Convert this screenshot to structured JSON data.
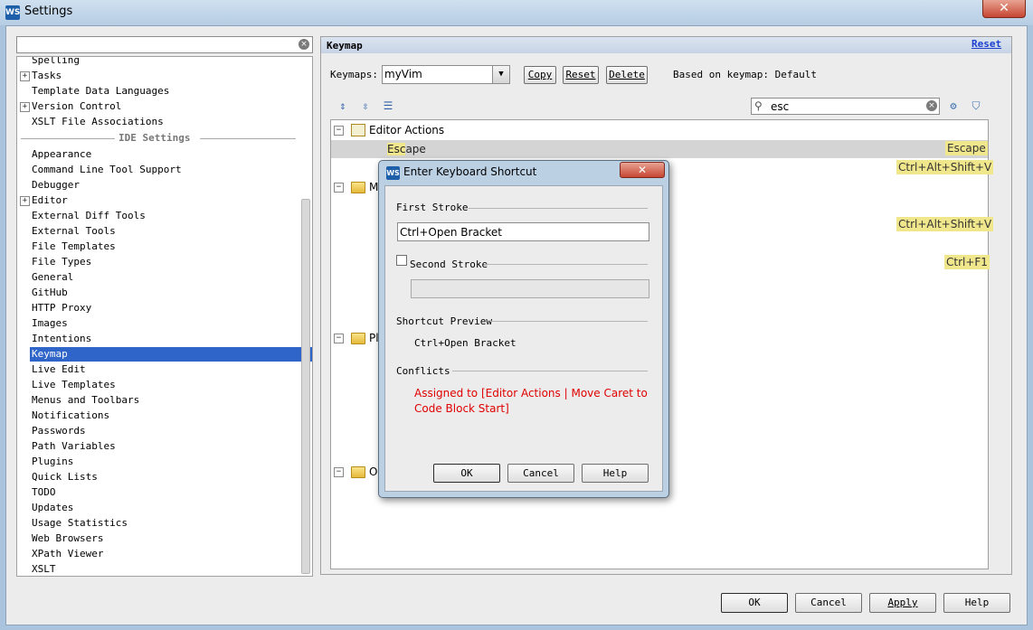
{
  "window": {
    "title": "Settings",
    "close_glyph": "✕",
    "app_icon": "WS"
  },
  "search": {
    "value": ""
  },
  "settings_tree": {
    "items_top": [
      {
        "label": "Spelling",
        "expandable": false
      },
      {
        "label": "Tasks",
        "expandable": true
      },
      {
        "label": "Template Data Languages",
        "expandable": false
      },
      {
        "label": "Version Control",
        "expandable": true
      },
      {
        "label": "XSLT File Associations",
        "expandable": false
      }
    ],
    "section_label": "IDE Settings",
    "items_ide": [
      {
        "label": "Appearance",
        "expandable": false
      },
      {
        "label": "Command Line Tool Support",
        "expandable": false
      },
      {
        "label": "Debugger",
        "expandable": false
      },
      {
        "label": "Editor",
        "expandable": true
      },
      {
        "label": "External Diff Tools",
        "expandable": false
      },
      {
        "label": "External Tools",
        "expandable": false
      },
      {
        "label": "File Templates",
        "expandable": false
      },
      {
        "label": "File Types",
        "expandable": false
      },
      {
        "label": "General",
        "expandable": false
      },
      {
        "label": "GitHub",
        "expandable": false
      },
      {
        "label": "HTTP Proxy",
        "expandable": false
      },
      {
        "label": "Images",
        "expandable": false
      },
      {
        "label": "Intentions",
        "expandable": false
      },
      {
        "label": "Keymap",
        "expandable": false,
        "selected": true
      },
      {
        "label": "Live Edit",
        "expandable": false
      },
      {
        "label": "Live Templates",
        "expandable": false
      },
      {
        "label": "Menus and Toolbars",
        "expandable": false
      },
      {
        "label": "Notifications",
        "expandable": false
      },
      {
        "label": "Passwords",
        "expandable": false
      },
      {
        "label": "Path Variables",
        "expandable": false
      },
      {
        "label": "Plugins",
        "expandable": false
      },
      {
        "label": "Quick Lists",
        "expandable": false
      },
      {
        "label": "TODO",
        "expandable": false
      },
      {
        "label": "Updates",
        "expandable": false
      },
      {
        "label": "Usage Statistics",
        "expandable": false
      },
      {
        "label": "Web Browsers",
        "expandable": false
      },
      {
        "label": "XPath Viewer",
        "expandable": false
      },
      {
        "label": "XSLT",
        "expandable": false
      }
    ]
  },
  "keymap_panel": {
    "header_title": "Keymap",
    "header_reset": "Reset",
    "keymaps_label": "Keymaps:",
    "keymap_selected": "myVim",
    "copy": "Copy",
    "reset": "Reset",
    "delete": "Delete",
    "based_on": "Based on keymap: Default",
    "filter_value": "esc",
    "tree": {
      "root_label": "Editor Actions",
      "selected_row_match": "Esc",
      "selected_row_rest": "ape",
      "folder_fragments": [
        "M",
        "Pl",
        "O"
      ]
    },
    "shortcuts": [
      "Escape",
      "Ctrl+Alt+Shift+V",
      "Ctrl+Alt+Shift+V",
      "Ctrl+F1"
    ]
  },
  "dialog": {
    "title": "Enter Keyboard Shortcut",
    "close_glyph": "✕",
    "first_stroke_label": "First Stroke",
    "first_stroke_value": "Ctrl+Open Bracket",
    "second_stroke_label": "Second Stroke",
    "second_stroke_value": "",
    "preview_label": "Shortcut Preview",
    "preview_value": "Ctrl+Open Bracket",
    "conflicts_label": "Conflicts",
    "conflict_text": "Assigned to [Editor Actions | Move Caret to Code Block Start]",
    "ok": "OK",
    "cancel": "Cancel",
    "help": "Help"
  },
  "footer": {
    "ok": "OK",
    "cancel": "Cancel",
    "apply": "Apply",
    "help": "Help"
  },
  "colors": {
    "selection": "#2f65c8",
    "shortcut_highlight": "#f0e68c",
    "conflict_text": "#e00000",
    "link": "#1c3fd0"
  }
}
